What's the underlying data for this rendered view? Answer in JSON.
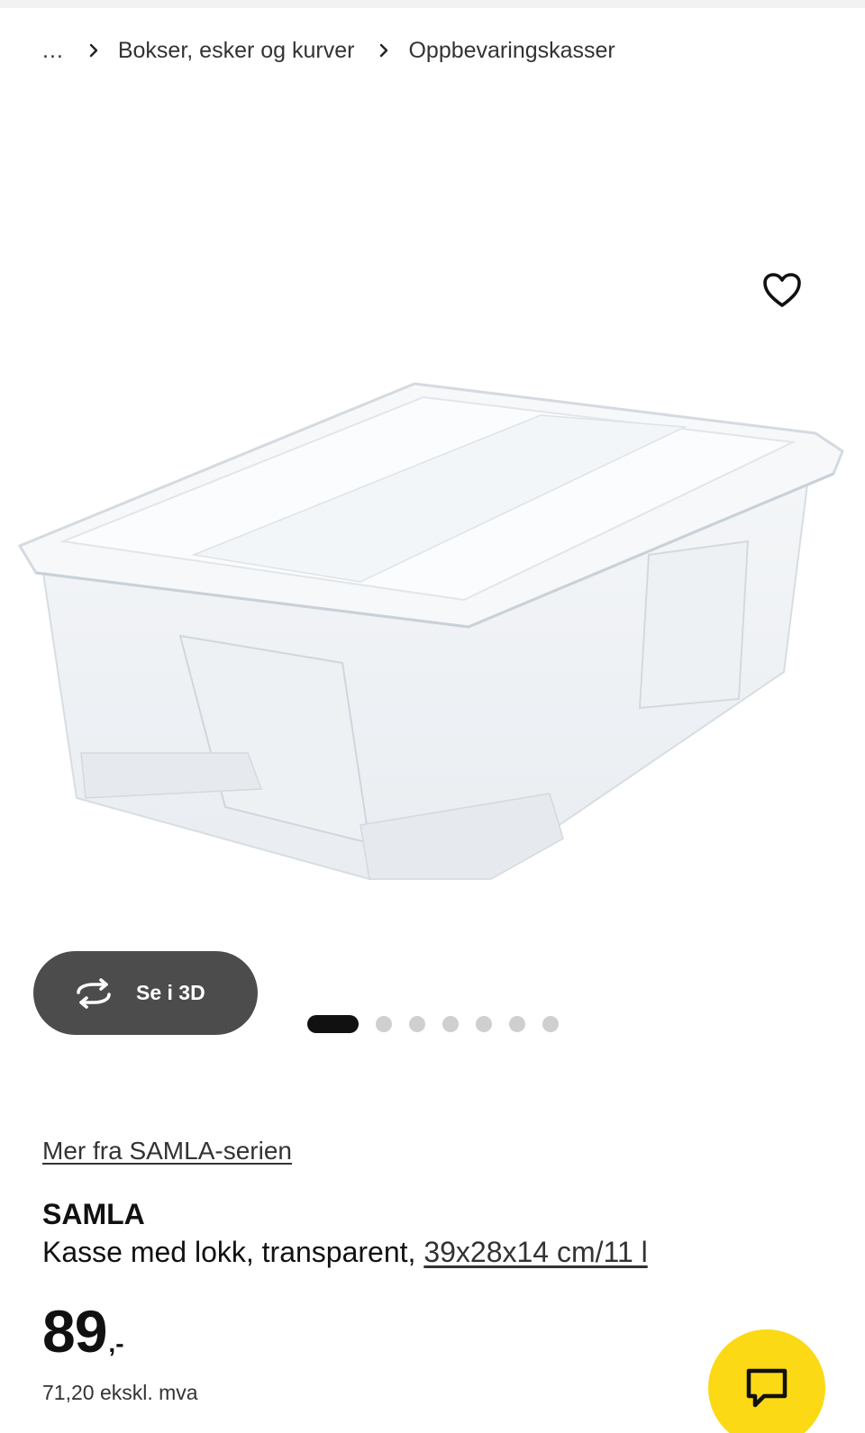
{
  "breadcrumb": {
    "ellipsis": "...",
    "items": [
      "Bokser, esker og kurver",
      "Oppbevaringskasser"
    ]
  },
  "media": {
    "image_alt": "SAMLA Kasse med lokk, transparent",
    "view_3d_label": "Se i 3D",
    "carousel": {
      "total": 7,
      "active": 1
    }
  },
  "product": {
    "series_link": "Mer fra SAMLA-serien",
    "name": "SAMLA",
    "description_prefix": "Kasse med lokk, transparent,",
    "dimensions": "39x28x14 cm/11 l",
    "price_integer": "89",
    "price_suffix": ",-",
    "price_ex_vat": "71,20 ekskl. mva"
  },
  "icons": {
    "favorite": "heart-icon",
    "rotate_3d": "rotate-3d-icon",
    "chat": "chat-bubble-icon",
    "breadcrumb_separator": "chevron-right-icon"
  },
  "colors": {
    "chat_button": "#fbd914",
    "button_3d": "#4c4c4c",
    "active_dot": "#111111",
    "inactive_dot": "#cfcfcf"
  }
}
